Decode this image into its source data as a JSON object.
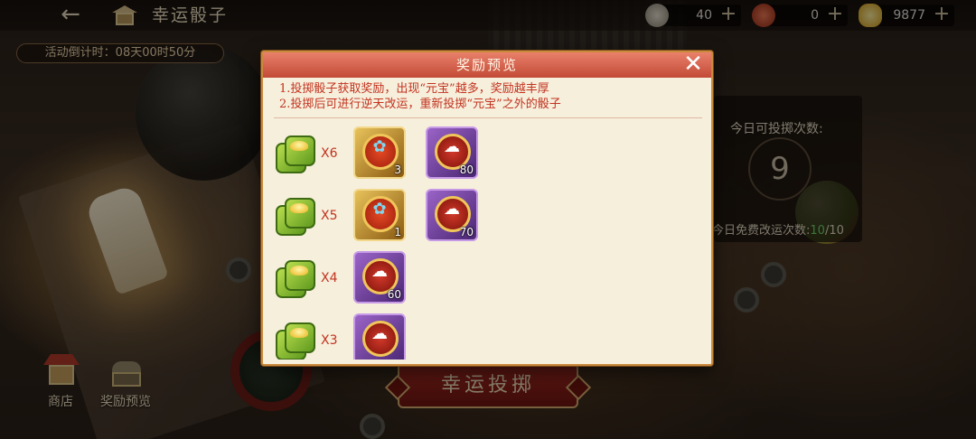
{
  "header": {
    "back_icon": "back-arrow-icon",
    "title": "幸运骰子",
    "currencies": [
      {
        "name": "silver-token",
        "value": "40",
        "color": "#c9c2b4"
      },
      {
        "name": "red-token",
        "value": "0",
        "color": "#c94b2f"
      },
      {
        "name": "gold-ingot",
        "value": "9877",
        "color": "#e5b93a"
      }
    ]
  },
  "timer": {
    "label": "活动倒计时：08天00时50分"
  },
  "side_panel": {
    "label": "今日可投掷次数:",
    "count": "9",
    "free_label": "今日免费改运次数:",
    "free_used": "10",
    "free_sep": "/",
    "free_total": "10"
  },
  "bottom_left": {
    "shop_label": "商店",
    "preview_label": "奖励预览"
  },
  "roll_button": {
    "label": "幸运投掷"
  },
  "modal": {
    "title": "奖励预览",
    "rule_1": "1.投掷骰子获取奖励，出现“元宝”越多，奖励越丰厚",
    "rule_2": "2.投掷后可进行逆天改运，重新投掷“元宝”之外的骰子",
    "rows": [
      {
        "mult": "X6",
        "items": [
          {
            "frame": "gold",
            "icon": "phoenix-medal-icon",
            "qty": "3"
          },
          {
            "frame": "purple",
            "icon": "cloud-medal-icon",
            "qty": "80"
          }
        ]
      },
      {
        "mult": "X5",
        "items": [
          {
            "frame": "gold",
            "icon": "phoenix-medal-icon",
            "qty": "1"
          },
          {
            "frame": "purple",
            "icon": "cloud-medal-icon",
            "qty": "70"
          }
        ]
      },
      {
        "mult": "X4",
        "items": [
          {
            "frame": "purple",
            "icon": "cloud-medal-icon",
            "qty": "60"
          }
        ]
      },
      {
        "mult": "X3",
        "items": [
          {
            "frame": "purple",
            "icon": "cloud-medal-icon",
            "qty": ""
          }
        ]
      }
    ]
  }
}
